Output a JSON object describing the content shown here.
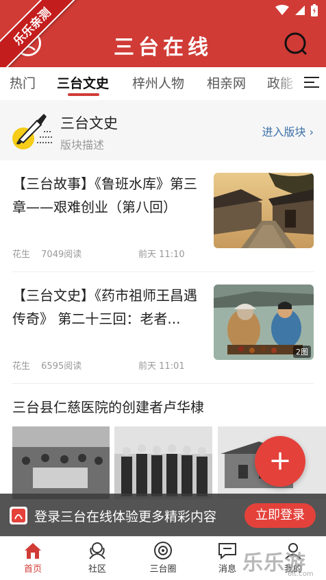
{
  "header": {
    "title": "三台在线",
    "ribbon": "乐乐亲测"
  },
  "tabs": [
    {
      "label": "热门"
    },
    {
      "label": "三台文史"
    },
    {
      "label": "梓州人物"
    },
    {
      "label": "相亲网"
    },
    {
      "label": "政能"
    }
  ],
  "section": {
    "title": "三台文史",
    "description": "版块描述",
    "enter_label": "进入版块 ›"
  },
  "articles": [
    {
      "title": "【三台故事】《鲁班水库》第三章——艰难创业（第八回）",
      "author": "花生",
      "reads": "7049阅读",
      "time": "前天 11:10"
    },
    {
      "title": "【三台文史】《药市祖师王昌遇传奇》 第二十三回：老者...",
      "author": "花生",
      "reads": "6595阅读",
      "time": "前天 11:01",
      "image_count": "2图"
    }
  ],
  "article3": {
    "title": "三台县仁慈医院的创建者卢华棣"
  },
  "fab": {
    "label": "+"
  },
  "login_bar": {
    "text": "登录三台在线体验更多精彩内容",
    "button": "立即登录"
  },
  "bottom_nav": [
    {
      "label": "首页"
    },
    {
      "label": "社区"
    },
    {
      "label": "三台圈"
    },
    {
      "label": "消息"
    },
    {
      "label": "我的"
    }
  ],
  "watermark": {
    "text": "乐乐游戏",
    "sub": "6lt.com"
  },
  "colors": {
    "brand": "#d03b36",
    "accent": "#e4413b",
    "link": "#3b6fa8"
  }
}
